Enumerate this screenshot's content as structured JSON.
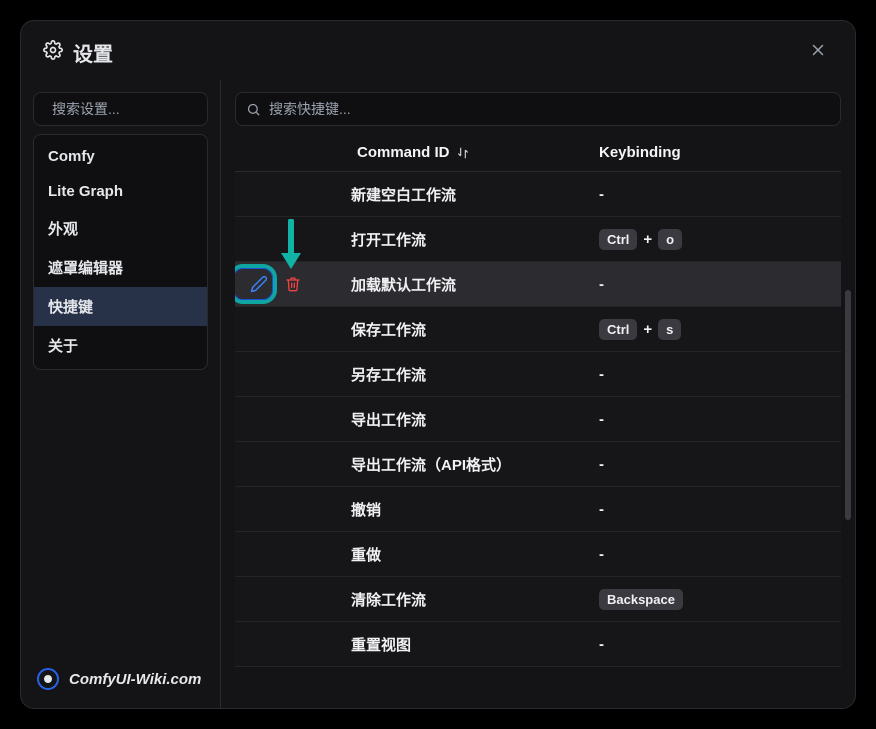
{
  "header": {
    "title": "设置"
  },
  "sidebar": {
    "search_placeholder": "搜索设置...",
    "items": [
      {
        "label": "Comfy"
      },
      {
        "label": "Lite Graph"
      },
      {
        "label": "外观"
      },
      {
        "label": "遮罩编辑器"
      },
      {
        "label": "快捷键"
      },
      {
        "label": "关于"
      }
    ],
    "active_index": 4,
    "brand": "ComfyUI-Wiki.com"
  },
  "main": {
    "search_placeholder": "搜索快捷键...",
    "columns": {
      "command": "Command ID",
      "keybinding": "Keybinding"
    },
    "plus": "+",
    "dash": "-",
    "rows": [
      {
        "command": "新建空白工作流",
        "keys": []
      },
      {
        "command": "打开工作流",
        "keys": [
          "Ctrl",
          "o"
        ]
      },
      {
        "command": "加载默认工作流",
        "keys": [],
        "highlight": true,
        "show_actions": true
      },
      {
        "command": "保存工作流",
        "keys": [
          "Ctrl",
          "s"
        ]
      },
      {
        "command": "另存工作流",
        "keys": []
      },
      {
        "command": "导出工作流",
        "keys": []
      },
      {
        "command": "导出工作流（API格式）",
        "keys": []
      },
      {
        "command": "撤销",
        "keys": []
      },
      {
        "command": "重做",
        "keys": []
      },
      {
        "command": "清除工作流",
        "keys": [
          "Backspace"
        ]
      },
      {
        "command": "重置视图",
        "keys": []
      }
    ]
  },
  "colors": {
    "accent_ring": "#0ea5a3",
    "arrow": "#11b3a5",
    "edit_icon": "#3b82f6",
    "delete_icon": "#ef4444"
  }
}
